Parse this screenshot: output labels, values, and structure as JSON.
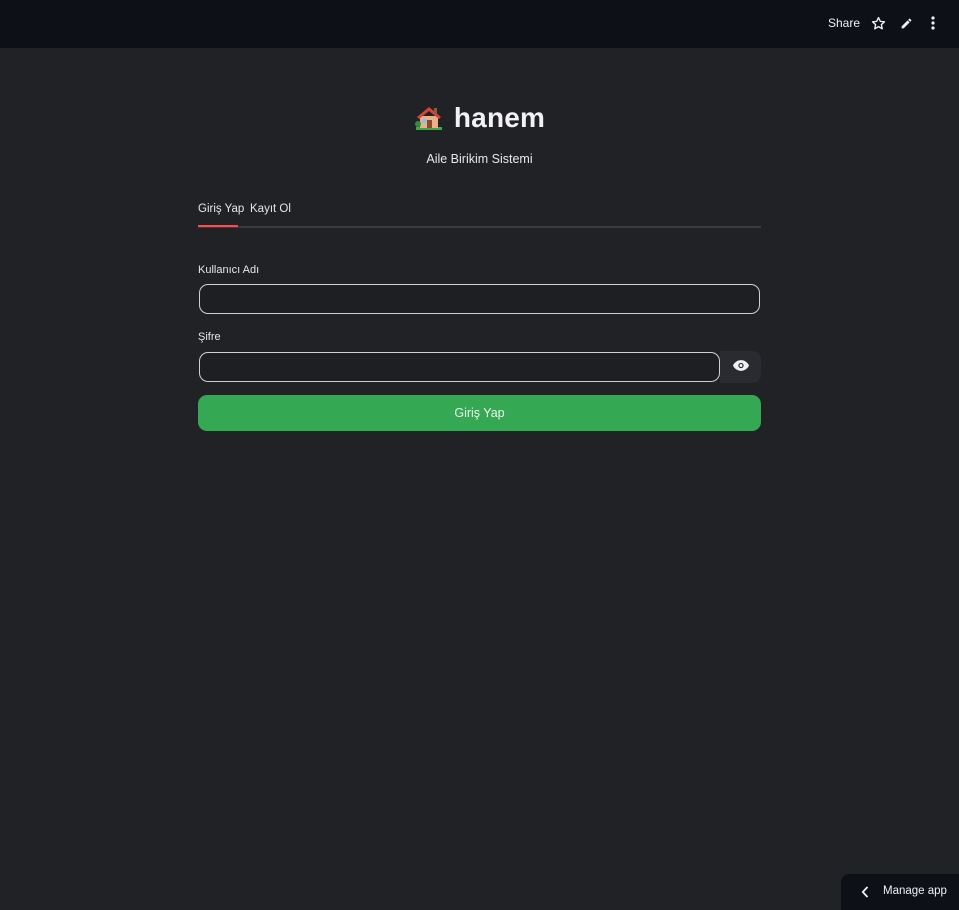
{
  "header": {
    "share_label": "Share",
    "icons": [
      "star-icon",
      "pencil-icon",
      "more-vertical-icon"
    ]
  },
  "brand": {
    "emoji_icon": "house-icon",
    "title": "hanem",
    "subtitle": "Aile Birikim Sistemi"
  },
  "tabs": [
    {
      "label": "Giriş Yap",
      "active": true
    },
    {
      "label": "Kayıt Ol",
      "active": false
    }
  ],
  "form": {
    "username_label": "Kullanıcı Adı",
    "username_value": "",
    "password_label": "Şifre",
    "password_value": "",
    "submit_label": "Giriş Yap"
  },
  "footer": {
    "manage_label": "Manage app"
  },
  "colors": {
    "background": "#212226",
    "topbar": "#0d1017",
    "accent_tab": "#ff4b4b",
    "submit_button": "#34a853"
  }
}
